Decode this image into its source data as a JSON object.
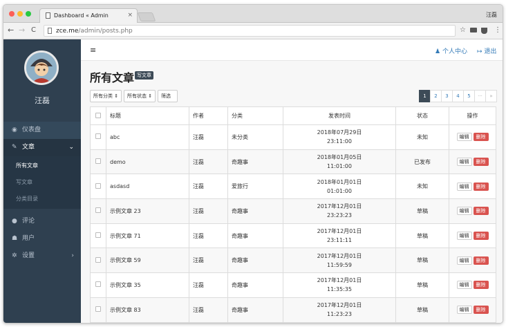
{
  "browser": {
    "tab_title": "Dashboard « Admin",
    "tab_close": "×",
    "profile_name": "汪磊",
    "url_host": "zce.me",
    "url_path": "/admin/posts.php"
  },
  "sidebar": {
    "username": "汪磊",
    "menu": {
      "dashboard": "仪表盘",
      "posts": "文章",
      "posts_sub": [
        "所有文章",
        "写文章",
        "分类目录"
      ],
      "comments": "评论",
      "users": "用户",
      "settings": "设置"
    }
  },
  "topbar": {
    "profile_link": "个人中心",
    "logout_link": "退出"
  },
  "page": {
    "title": "所有文章",
    "title_badge": "写文章"
  },
  "filters": {
    "category_select": "所有分类",
    "status_select": "所有状态",
    "filter_button": "筛选"
  },
  "pagination": {
    "pages": [
      "1",
      "2",
      "3",
      "4",
      "5"
    ],
    "active_page": "1",
    "ellipsis": "···",
    "next": "»"
  },
  "table": {
    "headers": {
      "title": "标题",
      "author": "作者",
      "category": "分类",
      "time": "发表时间",
      "status": "状态",
      "actions": "操作"
    },
    "edit_label": "编辑",
    "delete_label": "删除",
    "rows": [
      {
        "title": "abc",
        "author": "汪磊",
        "category": "未分类",
        "date": "2018年07月29日",
        "time": "23:11:00",
        "status": "未知"
      },
      {
        "title": "demo",
        "author": "汪磊",
        "category": "奇趣事",
        "date": "2018年01月05日",
        "time": "11:01:00",
        "status": "已发布"
      },
      {
        "title": "asdasd",
        "author": "汪磊",
        "category": "爱旅行",
        "date": "2018年01月01日",
        "time": "01:01:00",
        "status": "未知"
      },
      {
        "title": "示例文章 23",
        "author": "汪磊",
        "category": "奇趣事",
        "date": "2017年12月01日",
        "time": "23:23:23",
        "status": "草稿"
      },
      {
        "title": "示例文章 71",
        "author": "汪磊",
        "category": "奇趣事",
        "date": "2017年12月01日",
        "time": "23:11:11",
        "status": "草稿"
      },
      {
        "title": "示例文章 59",
        "author": "汪磊",
        "category": "奇趣事",
        "date": "2017年12月01日",
        "time": "11:59:59",
        "status": "草稿"
      },
      {
        "title": "示例文章 35",
        "author": "汪磊",
        "category": "奇趣事",
        "date": "2017年12月01日",
        "time": "11:35:35",
        "status": "草稿"
      },
      {
        "title": "示例文章 83",
        "author": "汪磊",
        "category": "奇趣事",
        "date": "2017年12月01日",
        "time": "11:23:23",
        "status": "草稿"
      }
    ]
  },
  "colors": {
    "sidebar_bg": "#2f4050",
    "dark_badge": "#3d4b57",
    "danger": "#d9534f",
    "link": "#337ab7"
  }
}
